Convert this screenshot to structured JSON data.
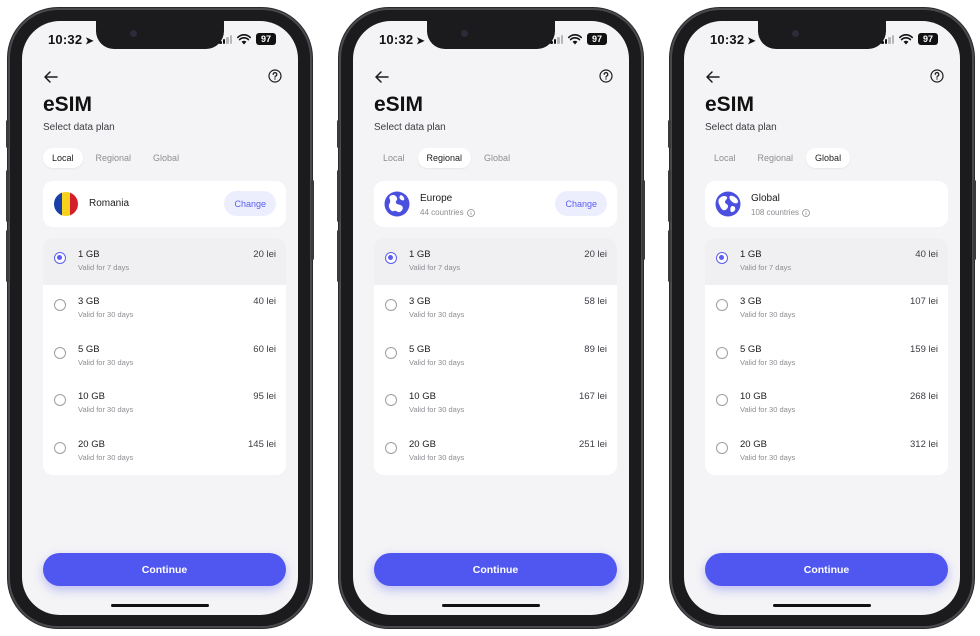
{
  "status": {
    "time": "10:32",
    "battery": "97"
  },
  "header": {
    "title": "eSIM",
    "subtitle": "Select data plan"
  },
  "tab_labels": [
    "Local",
    "Regional",
    "Global"
  ],
  "change_label": "Change",
  "continue_label": "Continue",
  "colors": {
    "accent": "#5056f0",
    "accent_soft": "#eceefe",
    "screen_bg": "#f4f4f6"
  },
  "phones": [
    {
      "active_tab": "Local",
      "destination": {
        "name": "Romania",
        "sub": "",
        "icon": "romania-flag-icon",
        "show_change": true
      },
      "plans": [
        {
          "data": "1 GB",
          "validity": "Valid for 7 days",
          "price": "20 lei",
          "selected": true
        },
        {
          "data": "3 GB",
          "validity": "Valid for 30 days",
          "price": "40 lei",
          "selected": false
        },
        {
          "data": "5 GB",
          "validity": "Valid for 30 days",
          "price": "60 lei",
          "selected": false
        },
        {
          "data": "10 GB",
          "validity": "Valid for 30 days",
          "price": "95 lei",
          "selected": false
        },
        {
          "data": "20 GB",
          "validity": "Valid for 30 days",
          "price": "145 lei",
          "selected": false
        }
      ]
    },
    {
      "active_tab": "Regional",
      "destination": {
        "name": "Europe",
        "sub": "44 countries",
        "icon": "europe-globe-icon",
        "show_change": true
      },
      "plans": [
        {
          "data": "1 GB",
          "validity": "Valid for 7 days",
          "price": "20 lei",
          "selected": true
        },
        {
          "data": "3 GB",
          "validity": "Valid for 30 days",
          "price": "58 lei",
          "selected": false
        },
        {
          "data": "5 GB",
          "validity": "Valid for 30 days",
          "price": "89 lei",
          "selected": false
        },
        {
          "data": "10 GB",
          "validity": "Valid for 30 days",
          "price": "167 lei",
          "selected": false
        },
        {
          "data": "20 GB",
          "validity": "Valid for 30 days",
          "price": "251 lei",
          "selected": false
        }
      ]
    },
    {
      "active_tab": "Global",
      "destination": {
        "name": "Global",
        "sub": "108 countries",
        "icon": "world-globe-icon",
        "show_change": false
      },
      "plans": [
        {
          "data": "1 GB",
          "validity": "Valid for 7 days",
          "price": "40 lei",
          "selected": true
        },
        {
          "data": "3 GB",
          "validity": "Valid for 30 days",
          "price": "107 lei",
          "selected": false
        },
        {
          "data": "5 GB",
          "validity": "Valid for 30 days",
          "price": "159 lei",
          "selected": false
        },
        {
          "data": "10 GB",
          "validity": "Valid for 30 days",
          "price": "268 lei",
          "selected": false
        },
        {
          "data": "20 GB",
          "validity": "Valid for 30 days",
          "price": "312 lei",
          "selected": false
        }
      ]
    }
  ]
}
